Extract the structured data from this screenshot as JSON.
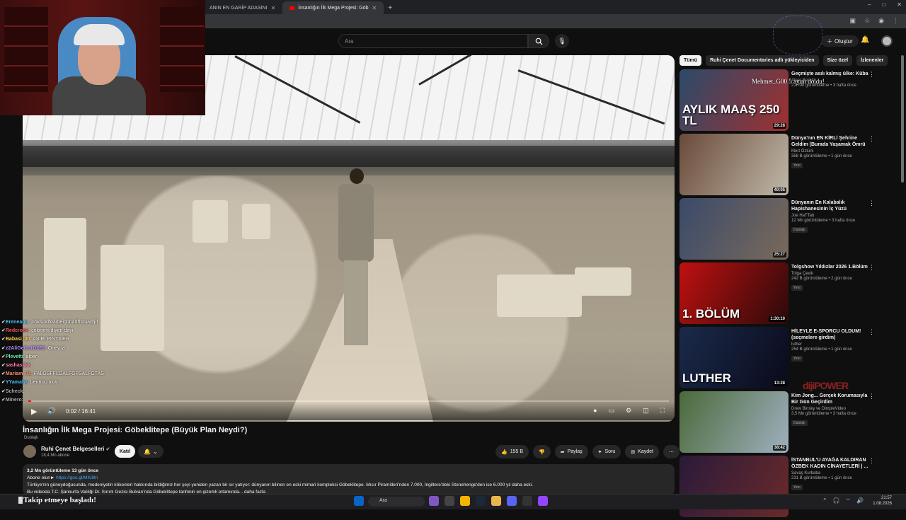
{
  "browser": {
    "tabs": [
      {
        "label": "ANIN EN GARİP ADASINI"
      },
      {
        "label": "İnsanlığın İlk Mega Projesi: Göb"
      }
    ],
    "window_controls": [
      "–",
      "□",
      "✕"
    ]
  },
  "youtube": {
    "search_placeholder": "Ara",
    "create_label": "Oluştur"
  },
  "video": {
    "time": "0:02 / 16:41",
    "progress_fraction": 0.002,
    "title": "İnsanlığın İlk Mega Projesi: Göbeklitepe (Büyük Plan Neydi?)",
    "dub_label": "Dublajlı",
    "channel": "Ruhi Çenet Belgeselleri",
    "subscribers": "18,4 Mn abone",
    "join_label": "Katıl",
    "likes": "155 B",
    "share_label": "Paylaş",
    "ask_label": "Soru",
    "save_label": "Kaydet",
    "description": {
      "stats": "3,2 Mn görüntüleme  13 gün önce",
      "cta": "Abone olun►",
      "link": "https://goo.gl/MKi8tn",
      "text1": "Türkiye'nin güneydoğusunda, medeniyetin kökenleri hakkında bildiğimiz her şeyi yeniden yazan bir sır yatıyor: dünyanın bilinen en eski mimari kompleksi Göbeklitepe. Mısır Piramitleri'nden 7.000, İngiltere'deki Stonehenge'den ise 6.000 yıl daha eski.",
      "text2": "Bu videoda T.C. Şanlıurfa Valiliği Dr. Sınırlı Gezisi Bulvarı'nda Göbeklitepe tarihinin en gizemli ortamında... daha fazla"
    }
  },
  "chat": [
    {
      "name": "Ereneana",
      "msg": "jnbksindfoadfeigbhadfhouadfjd",
      "color": "#4fc3f7"
    },
    {
      "name": "Redcroox",
      "msg": "çekmeyi diyen dayı",
      "color": "#ff5252"
    },
    {
      "name": "Babasi_00",
      "msg": "AŞIRI PİNTİLER",
      "color": "#ffd54f"
    },
    {
      "name": "z2AliGeCe1D2E2",
      "msg": "Öney la",
      "color": "#b388ff"
    },
    {
      "name": "Plevetti",
      "msg": "alper",
      "color": "#69f0ae"
    },
    {
      "name": "sashaskkk",
      "msg": "",
      "color": "#ff80ab"
    },
    {
      "name": "Mariam_Ta",
      "msg": "FALGSFFLGALFGFSALFGTAS",
      "color": "#ff8a65"
    },
    {
      "name": "YYamaha",
      "msg": "bentrop akar",
      "color": "#4fc3f7"
    },
    {
      "name": "Scheck",
      "msg": "",
      "color": "#aaaaaa"
    },
    {
      "name": "Minero",
      "msg": "",
      "color": "#aaaaaa"
    }
  ],
  "overlay": {
    "follow_text": "Takip etmeye başladı!",
    "mod_text": "Mehmet_G00 5 ayını doldu!",
    "watermark": "dijiPOWER"
  },
  "sidebar": {
    "chips": [
      "Tümü",
      "Ruhi Çenet Documentaries adlı yükleyiciden",
      "Size özel",
      "İzlenenler"
    ],
    "videos": [
      {
        "title": "Geçmişte asılı kalmış ülke: Küba",
        "channel": "Alper Rende",
        "meta": "2,4 Mn görüntüleme • 3 hafta önce",
        "duration": "29:28",
        "badge": "",
        "thumb_text": "AYLIK MAAŞ 250 TL",
        "c1": "#2b4a6a",
        "c2": "#a03030"
      },
      {
        "title": "Dünya'nın EN KİRLİ Şehrine Geldim (Burada Yaşamak Ömrü Kısaltıyor)",
        "channel": "Mert Öztürk",
        "meta": "358 B görüntüleme • 1 gün önce",
        "duration": "40:05",
        "badge": "Yeni",
        "thumb_text": "",
        "c1": "#6a4a3a",
        "c2": "#c0b8a8"
      },
      {
        "title": "Dünyanın En Kalabalık Hapishanesinin İç Yüzü",
        "channel": "Joe HaTTab",
        "meta": "12 Mn görüntüleme • 3 hafta önce",
        "duration": "25:27",
        "badge": "Dublajlı",
        "thumb_text": "",
        "c1": "#3a4a6a",
        "c2": "#7a6a5a"
      },
      {
        "title": "Tolgshow Yıldızlar 2026 1.Bölüm",
        "channel": "Tolga Çevik",
        "meta": "242 B görüntüleme • 2 gün önce",
        "duration": "1:30:10",
        "badge": "Yeni",
        "thumb_text": "1. BÖLÜM",
        "c1": "#c01010",
        "c2": "#2a0a0a"
      },
      {
        "title": "HİLEYLE E-SPORCU OLDUM! (seçmelere girdim)",
        "channel": "luther",
        "meta": "254 B görüntüleme • 1 gün önce",
        "duration": "13:28",
        "badge": "Yeni",
        "thumb_text": "LUTHER",
        "c1": "#1a2a4a",
        "c2": "#0a0a1a"
      },
      {
        "title": "Kim Jong... Gerçek Korumasıyla Bir Gün Geçirdim",
        "channel": "Drew Binsky ve DimpleVideo",
        "meta": "3,5 Mn görüntüleme • 3 hafta önce",
        "duration": "38:42",
        "badge": "Dublajlı",
        "thumb_text": "",
        "c1": "#4a6a3a",
        "c2": "#a0b0c0"
      },
      {
        "title": "İSTANBUL'U AYAĞA KALDIRAN ÖZBEK KADIN CİNAYETLERİ | ...",
        "channel": "Savaş Kurbaba",
        "meta": "231 B görüntüleme • 1 gün önce",
        "duration": "",
        "badge": "Yeni",
        "thumb_text": "",
        "c1": "#2a1a3a",
        "c2": "#6a2a2a"
      }
    ]
  },
  "taskbar": {
    "search": "Ara",
    "time": "21:57",
    "date": "1.08.2026"
  }
}
